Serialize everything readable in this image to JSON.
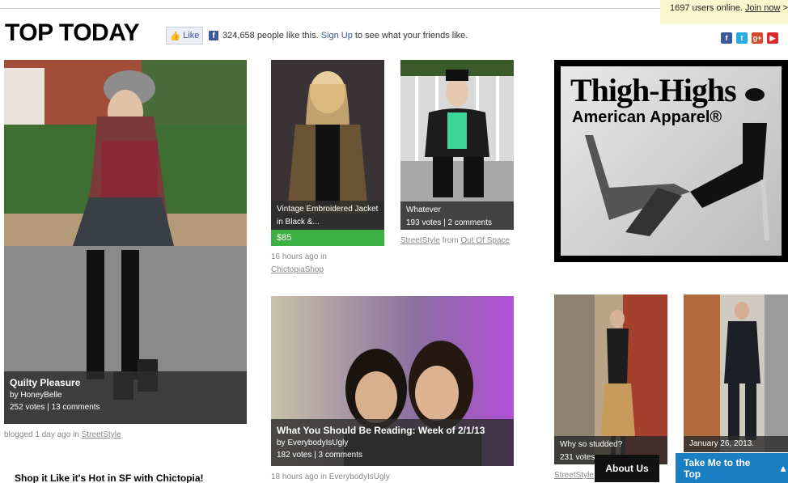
{
  "header": {
    "online_count": "1697 users online.",
    "join_link": "Join now",
    "join_arrow": ">",
    "title": "TOP TODAY",
    "like_button": "Like",
    "like_count_text": "324,658 people like this.",
    "signup_link": "Sign Up",
    "signup_suffix": "to see what your friends like."
  },
  "social_icons": [
    {
      "name": "facebook-icon",
      "glyph": "f",
      "color": "#3b5998"
    },
    {
      "name": "twitter-icon",
      "glyph": "t",
      "color": "#29a9e1"
    },
    {
      "name": "google-plus-icon",
      "glyph": "g+",
      "color": "#d6492f"
    },
    {
      "name": "youtube-icon",
      "glyph": "▶",
      "color": "#d92b2b"
    }
  ],
  "cards": {
    "quilty": {
      "title": "Quilty Pleasure",
      "by": "by HoneyBelle",
      "stats": "252 votes | 13 comments",
      "meta_prefix": "blogged 1 day ago in",
      "meta_link": "StreetStyle"
    },
    "vintage": {
      "title": "Vintage Embroidered Jacket in Black &...",
      "price": "$85",
      "meta_time": "16 hours ago in",
      "meta_link": "ChictopiaShop"
    },
    "whatever": {
      "title": "Whatever",
      "stats": "193 votes | 2 comments",
      "meta_link1": "StreetStyle",
      "meta_mid": "from",
      "meta_link2": "Out Of Space"
    },
    "reading": {
      "title": "What You Should Be Reading: Week of 2/1/13",
      "by": "by EverybodyIsUgly",
      "stats": "182 votes | 3 comments",
      "meta_text": "18 hours ago in EverybodyIsUgly"
    },
    "studded": {
      "title": "Why so studded?",
      "stats": "231 votes",
      "meta_link": "StreetStyle"
    },
    "january": {
      "title": "January 26, 2013."
    }
  },
  "ad": {
    "line1": "Thigh-Highs",
    "line2": "American Apparel®"
  },
  "footer": {
    "promo_text": "Shop it Like it's Hot in SF with Chictopia!",
    "about_button": "About Us",
    "top_button": "Take Me to the Top",
    "top_arrow": "▲"
  }
}
